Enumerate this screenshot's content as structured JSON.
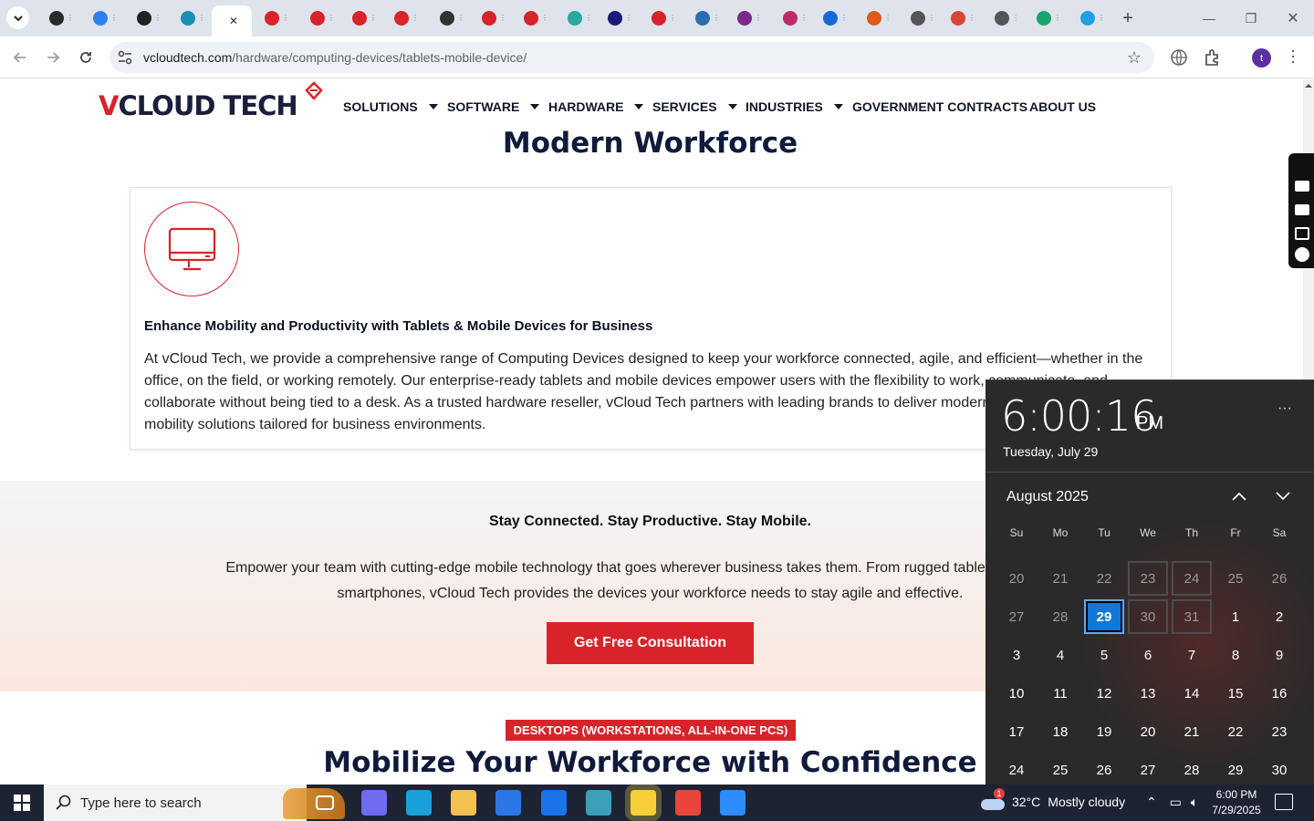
{
  "browser": {
    "url_host": "vcloudtech.com",
    "url_path": "/hardware/computing-devices/tablets-mobile-device/",
    "profile_initial": "t",
    "tabs": [
      {
        "icon": "clock-icon",
        "color": "#2b2b2b"
      },
      {
        "icon": "wifi-icon",
        "color": "#2f80ed"
      },
      {
        "icon": "openai-icon",
        "color": "#222"
      },
      {
        "icon": "play-icon",
        "color": "#1b8fb0"
      },
      {
        "icon": "active-tab-icon",
        "color": "#ffffff"
      },
      {
        "icon": "gem-icon",
        "color": "#d8232a"
      },
      {
        "icon": "gem-icon",
        "color": "#d8232a"
      },
      {
        "icon": "gem-icon",
        "color": "#d8232a"
      },
      {
        "icon": "gem-icon",
        "color": "#d8232a"
      },
      {
        "icon": "check-icon",
        "color": "#333"
      },
      {
        "icon": "gem-icon",
        "color": "#d8232a"
      },
      {
        "icon": "gem-icon",
        "color": "#d8232a"
      },
      {
        "icon": "globe-icon",
        "color": "#2aa7a0"
      },
      {
        "icon": "x-icon",
        "color": "#1a1a7a"
      },
      {
        "icon": "gem-icon",
        "color": "#d8232a"
      },
      {
        "icon": "scale-icon",
        "color": "#2b6cb0"
      },
      {
        "icon": "dots-icon",
        "color": "#7a2b8a"
      },
      {
        "icon": "arrow-icon",
        "color": "#c02a6a"
      },
      {
        "icon": "pulse-icon",
        "color": "#1769d6"
      },
      {
        "icon": "slash-icon",
        "color": "#e05a1a"
      },
      {
        "icon": "globe-icon",
        "color": "#555"
      },
      {
        "icon": "gmail-icon",
        "color": "#d44638"
      },
      {
        "icon": "globe-icon",
        "color": "#555"
      },
      {
        "icon": "d-icon",
        "color": "#1aa36a"
      },
      {
        "icon": "search-icon",
        "color": "#20a0e0"
      }
    ]
  },
  "site": {
    "logo_v": "V",
    "logo_rest": "CLOUD TECH",
    "nav": [
      {
        "label": "SOLUTIONS",
        "caret": true
      },
      {
        "label": "SOFTWARE",
        "caret": true
      },
      {
        "label": "HARDWARE",
        "caret": true
      },
      {
        "label": "SERVICES",
        "caret": true
      },
      {
        "label": "INDUSTRIES",
        "caret": true
      },
      {
        "label": "GOVERNMENT CONTRACTS",
        "caret": false
      },
      {
        "label": "ABOUT US",
        "caret": false
      }
    ],
    "hero_title": "Modern Workforce",
    "card_heading": "Enhance Mobility and Productivity with Tablets & Mobile Devices for Business",
    "card_body": "At vCloud Tech, we provide a comprehensive range of Computing Devices designed to keep your workforce connected, agile, and efficient—whether in the office, on the field, or working remotely. Our enterprise-ready tablets and mobile devices empower users with the flexibility to work, communicate, and collaborate without being tied to a desk. As a trusted hardware reseller, vCloud Tech partners with leading brands to deliver modern, secure, and scalable mobility solutions tailored for business environments.",
    "band_heading": "Stay Connected. Stay Productive. Stay Mobile.",
    "band_body": "Empower your team with cutting-edge mobile technology that goes wherever business takes them. From rugged tablets to business smartphones, vCloud Tech provides the devices your workforce needs to stay agile and effective.",
    "cta": "Get Free Consultation",
    "tag": "DESKTOPS (WORKSTATIONS, ALL-IN-ONE PCS)",
    "section_title": "Mobilize Your Workforce with Confidence"
  },
  "calendar": {
    "time": "6:00:16",
    "ampm": "PM",
    "date_line": "Tuesday, July 29",
    "month_label": "August 2025",
    "weekdays": [
      "Su",
      "Mo",
      "Tu",
      "We",
      "Th",
      "Fr",
      "Sa"
    ],
    "weeks": [
      [
        "20",
        "21",
        "22",
        "23",
        "24",
        "25",
        "26"
      ],
      [
        "27",
        "28",
        "29",
        "30",
        "31",
        "1",
        "2"
      ],
      [
        "3",
        "4",
        "5",
        "6",
        "7",
        "8",
        "9"
      ],
      [
        "10",
        "11",
        "12",
        "13",
        "14",
        "15",
        "16"
      ],
      [
        "17",
        "18",
        "19",
        "20",
        "21",
        "22",
        "23"
      ],
      [
        "24",
        "25",
        "26",
        "27",
        "28",
        "29",
        "30"
      ]
    ],
    "today": "29"
  },
  "taskbar": {
    "search_placeholder": "Type here to search",
    "weather_temp": "32°C",
    "weather_text": "Mostly cloudy",
    "weather_badge": "1",
    "clock_time": "6:00 PM",
    "clock_date": "7/29/2025",
    "apps": [
      {
        "icon": "task-view-icon",
        "color": "#ffffff"
      },
      {
        "icon": "copilot-icon",
        "color": "#6f6cf0"
      },
      {
        "icon": "edge-icon",
        "color": "#1aa0d8"
      },
      {
        "icon": "file-explorer-icon",
        "color": "#f2c14e"
      },
      {
        "icon": "store-icon",
        "color": "#2b78e4"
      },
      {
        "icon": "mail-icon",
        "color": "#1a73e8"
      },
      {
        "icon": "app-icon",
        "color": "#3aa0b8"
      },
      {
        "icon": "sticky-notes-icon",
        "color": "#f7d038"
      },
      {
        "icon": "chrome-icon",
        "color": "#e8453c"
      },
      {
        "icon": "zoom-icon",
        "color": "#2d8cff"
      }
    ]
  }
}
